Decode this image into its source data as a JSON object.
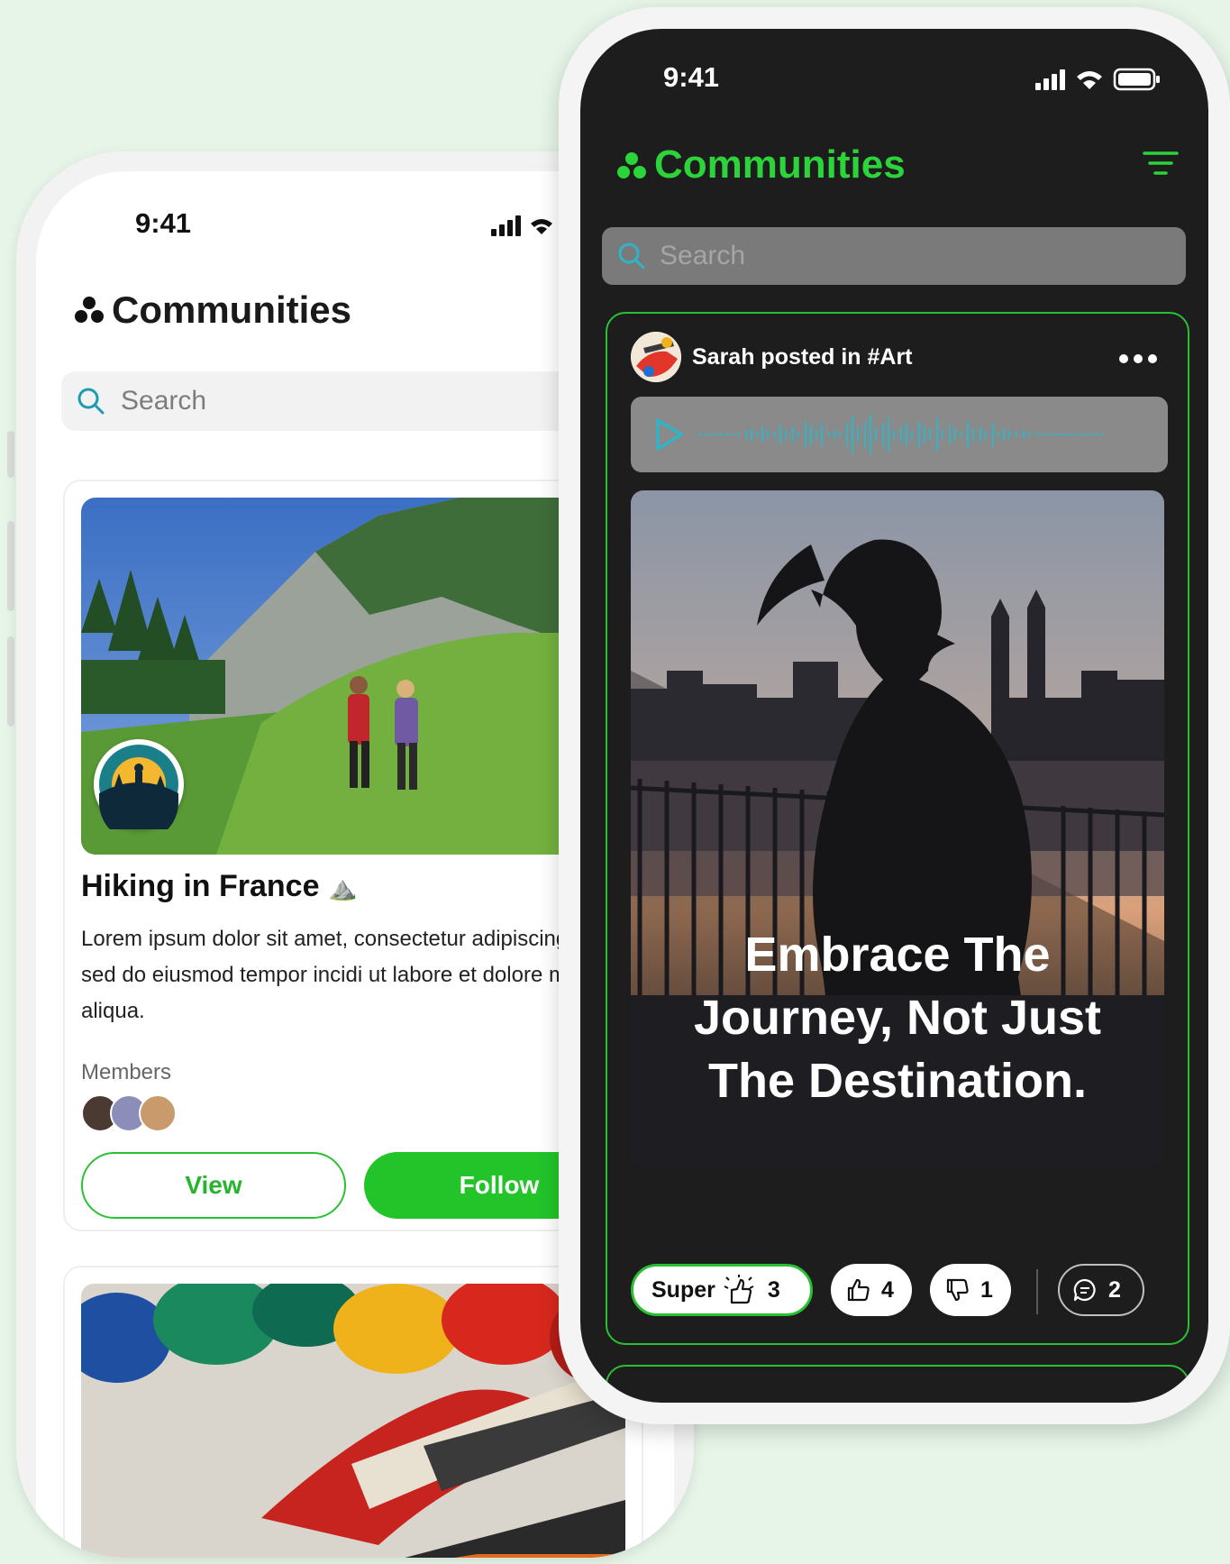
{
  "light_phone": {
    "status_time": "9:41",
    "app_title": "Communities",
    "search_placeholder": "Search",
    "card": {
      "title": "Hiking in France",
      "title_emoji": "⛰️",
      "description": "Lorem ipsum dolor sit amet, consectetur adipiscing elit, sed do eiusmod tempor incidi ut labore et dolore magna aliqua.",
      "members_label": "Members",
      "view_label": "View",
      "follow_label": "Follow"
    }
  },
  "dark_phone": {
    "status_time": "9:41",
    "app_title": "Communities",
    "search_placeholder": "Search",
    "post": {
      "poster_line": "Sarah posted in #Art",
      "quote_line1": "Embrace The",
      "quote_line2": "Journey, Not Just",
      "quote_line3": "The Destination.",
      "super_label": "Super",
      "super_count": "3",
      "like_count": "4",
      "dislike_count": "1",
      "comment_count": "2"
    }
  },
  "colors": {
    "background": "#e6f5e8",
    "accent_green": "#22c42a",
    "dark_screen": "#1d1d1d"
  }
}
